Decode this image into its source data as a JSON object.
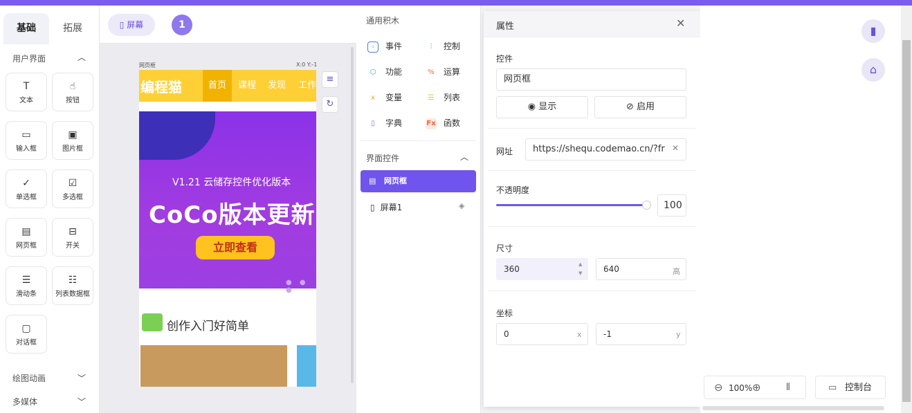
{
  "tabs": {
    "basic": "基础",
    "extend": "拓展"
  },
  "left": {
    "section_ui": "用户界面",
    "components": [
      {
        "label": "文本",
        "icon": "text-icon"
      },
      {
        "label": "按钮",
        "icon": "button-icon"
      },
      {
        "label": "输入框",
        "icon": "input-icon"
      },
      {
        "label": "图片框",
        "icon": "image-icon"
      },
      {
        "label": "单选框",
        "icon": "radio-icon"
      },
      {
        "label": "多选框",
        "icon": "checkbox-icon"
      },
      {
        "label": "网页框",
        "icon": "webview-icon"
      },
      {
        "label": "开关",
        "icon": "switch-icon"
      },
      {
        "label": "滑动条",
        "icon": "slider-icon"
      },
      {
        "label": "列表数据框",
        "icon": "list-icon"
      },
      {
        "label": "对话框",
        "icon": "dialog-icon"
      }
    ],
    "section_draw": "绘图动画",
    "section_media": "多媒体"
  },
  "toolbar": {
    "screen_label": "屏幕",
    "screen_count": "1"
  },
  "phone": {
    "frame_label": "网页框",
    "coords": "X:0 Y:-1",
    "logo": "编程猫",
    "nav": [
      "首页",
      "课程",
      "发现",
      "工作"
    ],
    "banner_line1": "V1.21 云储存控件优化版本",
    "banner_line2": "CoCo版本更新",
    "banner_button": "立即查看",
    "subtitle": "创作入门好简单"
  },
  "blocks": {
    "header_common": "通用积木",
    "items": [
      {
        "label": "事件",
        "color": "#4b7be0"
      },
      {
        "label": "控制",
        "color": "#2d8ce8"
      },
      {
        "label": "功能",
        "color": "#1ab3a6"
      },
      {
        "label": "运算",
        "color": "#f06a3a"
      },
      {
        "label": "变量",
        "color": "#f5a623"
      },
      {
        "label": "列表",
        "color": "#f5b82e"
      },
      {
        "label": "字典",
        "color": "#6a7ee8"
      },
      {
        "label": "函数",
        "color": "#f0663c"
      }
    ],
    "header_ui": "界面控件",
    "tree_active": "网页框",
    "tree_screen": "屏幕1"
  },
  "props": {
    "title": "属性",
    "control_label": "控件",
    "control_value": "网页框",
    "show_btn": "显示",
    "enable_btn": "启用",
    "url_label": "网址",
    "url_value": "https://shequ.codemao.cn/?fr",
    "opacity_label": "不透明度",
    "opacity_value": "100",
    "size_label": "尺寸",
    "width_value": "360",
    "height_value": "640",
    "height_suffix": "高",
    "pos_label": "坐标",
    "x_value": "0",
    "x_suffix": "x",
    "y_value": "-1",
    "y_suffix": "y"
  },
  "bottom": {
    "zoom": "100%",
    "console": "控制台"
  },
  "colors": {
    "accent": "#6f55ee",
    "top_bar": "#7a5cf0"
  }
}
